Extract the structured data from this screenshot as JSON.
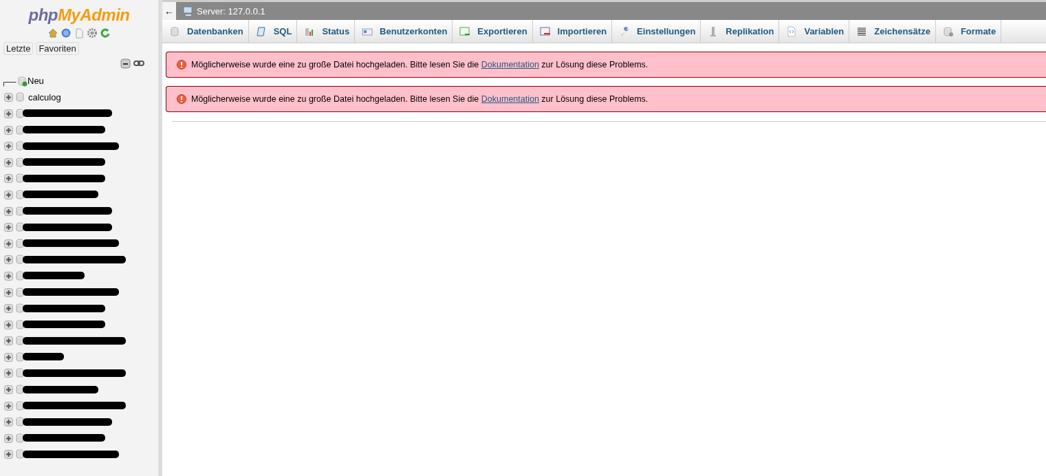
{
  "logo": {
    "first": "php",
    "second": "MyAdmin"
  },
  "sidebar": {
    "tabs": [
      "Letzte",
      "Favoriten"
    ],
    "new_item": "Neu",
    "databases": [
      {
        "name": "calculog",
        "redacted": false
      },
      {
        "redacted": true
      },
      {
        "redacted": true
      },
      {
        "redacted": true
      },
      {
        "redacted": true
      },
      {
        "redacted": true
      },
      {
        "redacted": true
      },
      {
        "redacted": true
      },
      {
        "redacted": true
      },
      {
        "redacted": true
      },
      {
        "redacted": true
      },
      {
        "redacted": true
      },
      {
        "redacted": true
      },
      {
        "redacted": true
      },
      {
        "redacted": true
      },
      {
        "redacted": true
      },
      {
        "redacted": true
      },
      {
        "redacted": true
      },
      {
        "redacted": true
      },
      {
        "redacted": true
      },
      {
        "redacted": true
      },
      {
        "redacted": true
      },
      {
        "redacted": true
      }
    ]
  },
  "topbar": {
    "back": "←",
    "server": "Server: 127.0.0.1"
  },
  "tabs": [
    {
      "label": "Datenbanken",
      "kind": "db"
    },
    {
      "label": "SQL",
      "kind": "sql"
    },
    {
      "label": "Status",
      "kind": "status"
    },
    {
      "label": "Benutzerkonten",
      "kind": "users"
    },
    {
      "label": "Exportieren",
      "kind": "export"
    },
    {
      "label": "Importieren",
      "kind": "import"
    },
    {
      "label": "Einstellungen",
      "kind": "settings"
    },
    {
      "label": "Replikation",
      "kind": "replication"
    },
    {
      "label": "Variablen",
      "kind": "variables"
    },
    {
      "label": "Zeichensätze",
      "kind": "charset"
    },
    {
      "label": "Formate",
      "kind": "engines"
    }
  ],
  "errors": [
    {
      "before": "Möglicherweise wurde eine zu große Datei hochgeladen. Bitte lesen Sie die",
      "link": "Dokumentation",
      "after": "zur Lösung diese Problems."
    },
    {
      "before": "Möglicherweise wurde eine zu große Datei hochgeladen. Bitte lesen Sie die",
      "link": "Dokumentation",
      "after": "zur Lösung diese Problems."
    }
  ]
}
